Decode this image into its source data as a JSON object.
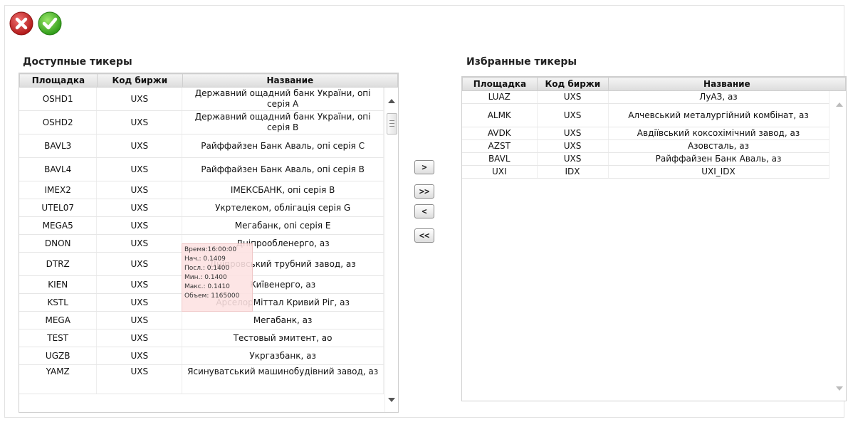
{
  "toolbar": {
    "cancel_icon": "cancel-icon",
    "confirm_icon": "confirm-icon"
  },
  "available": {
    "title": "Доступные тикеры",
    "columns": [
      "Площадка",
      "Код биржи",
      "Название"
    ],
    "rows": [
      [
        "OSHD1",
        "UXS",
        "Державний ощадний банк України, опі серія A"
      ],
      [
        "OSHD2",
        "UXS",
        "Державний ощадний банк України, опі серія B"
      ],
      [
        "BAVL3",
        "UXS",
        "Райффайзен Банк Аваль, опі серія C"
      ],
      [
        "BAVL4",
        "UXS",
        "Райффайзен Банк Аваль, опі серія B"
      ],
      [
        "IMEX2",
        "UXS",
        "ІМЕКСБАНК, опі серія B"
      ],
      [
        "UTEL07",
        "UXS",
        "Укртелеком, облігація серія G"
      ],
      [
        "MEGA5",
        "UXS",
        "Мегабанк, опі серія E"
      ],
      [
        "DNON",
        "UXS",
        "Дніпрообленерго, аз"
      ],
      [
        "DTRZ",
        "UXS",
        "Дніпровський трубний завод, аз"
      ],
      [
        "KIEN",
        "UXS",
        "Київенерго, аз"
      ],
      [
        "KSTL",
        "UXS",
        "АрселорМіттал Кривий Ріг, аз"
      ],
      [
        "MEGA",
        "UXS",
        "Мегабанк, аз"
      ],
      [
        "TEST",
        "UXS",
        "Тестовый эмитент, ао"
      ],
      [
        "UGZB",
        "UXS",
        "Укргазбанк, аз"
      ],
      [
        "YAMZ",
        "UXS",
        "Ясинуватський машинобудівний завод, аз"
      ]
    ]
  },
  "move_buttons": {
    "add_one": ">",
    "add_all": ">>",
    "remove_one": "<",
    "remove_all": "<<"
  },
  "selected": {
    "title": "Избранные тикеры",
    "columns": [
      "Площадка",
      "Код биржи",
      "Название"
    ],
    "rows": [
      [
        "LUAZ",
        "UXS",
        "ЛуАЗ, аз"
      ],
      [
        "ALMK",
        "UXS",
        "Алчевський металургійний комбінат, аз"
      ],
      [
        "AVDK",
        "UXS",
        "Авдіївський коксохімічний завод, аз"
      ],
      [
        "AZST",
        "UXS",
        "Азовсталь, аз"
      ],
      [
        "BAVL",
        "UXS",
        "Райффайзен Банк Аваль, аз"
      ],
      [
        "UXI",
        "IDX",
        "UXI_IDX"
      ]
    ]
  },
  "tooltip": {
    "time": "Время:16:00:00",
    "open": "Нач.: 0.1409",
    "last": "Посл.: 0.1400",
    "min": "Мин.: 0.1400",
    "max": "Макс.: 0.1410",
    "volume": "Объем: 1165000"
  }
}
